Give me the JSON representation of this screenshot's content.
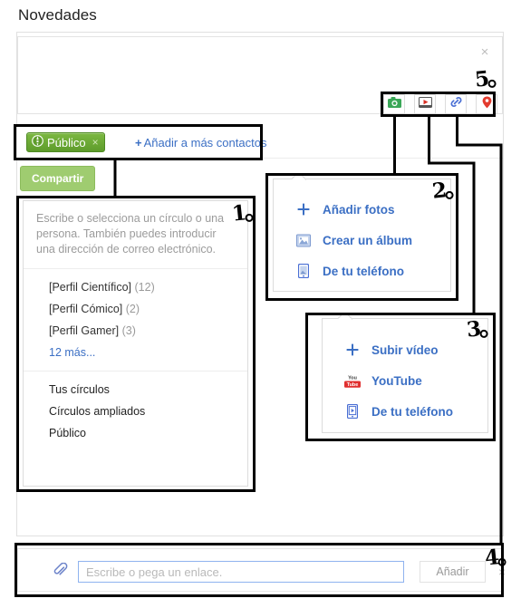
{
  "page": {
    "title": "Novedades"
  },
  "composer": {
    "placeholder": "",
    "close_icon": "close-icon",
    "close_glyph": "×"
  },
  "toolbar": {
    "buttons": [
      {
        "name": "add-photo-button",
        "icon": "camera-icon",
        "color": "#3aa757"
      },
      {
        "name": "add-video-button",
        "icon": "video-icon",
        "color": "#d93025"
      },
      {
        "name": "add-link-button",
        "icon": "link-icon",
        "color": "#4a6fd4"
      },
      {
        "name": "add-location-button",
        "icon": "location-pin-icon",
        "color": "#e33b2e"
      }
    ]
  },
  "audience": {
    "chip_label": "Público",
    "chip_icon": "globe-icon",
    "chip_remove_glyph": "×",
    "add_contacts_plus": "+",
    "add_contacts_label": "Añadir a más contactos",
    "chip_bg": "#5e9c2b"
  },
  "share": {
    "label": "Compartir"
  },
  "circles_dropdown": {
    "hint": "Escribe o selecciona un círculo o una persona. También puedes introducir una dirección de correo electrónico.",
    "circles": [
      {
        "label": "[Perfil Científico]",
        "count": "(12)"
      },
      {
        "label": "[Perfil Cómico]",
        "count": "(2)"
      },
      {
        "label": "[Perfil Gamer]",
        "count": "(3)"
      }
    ],
    "more_link": "12 más...",
    "scopes": [
      "Tus círculos",
      "Círculos ampliados",
      "Público"
    ]
  },
  "photo_popup": {
    "close_glyph": "×",
    "items": [
      {
        "label": "Añadir fotos",
        "icon": "plus-icon"
      },
      {
        "label": "Crear un álbum",
        "icon": "album-icon"
      },
      {
        "label": "De tu teléfono",
        "icon": "phone-icon"
      }
    ]
  },
  "video_popup": {
    "close_glyph": "×",
    "items": [
      {
        "label": "Subir vídeo",
        "icon": "plus-icon"
      },
      {
        "label": "YouTube",
        "icon": "youtube-icon"
      },
      {
        "label": "De tu teléfono",
        "icon": "phone-play-icon"
      }
    ]
  },
  "link_bar": {
    "icon": "paperclip-icon",
    "placeholder": "Escribe o pega un enlace.",
    "value": "",
    "add_label": "Añadir",
    "close_glyph": "×"
  },
  "annotations": {
    "n1": "1",
    "n2": "2",
    "n3": "3",
    "n4": "4",
    "n5": "5"
  }
}
